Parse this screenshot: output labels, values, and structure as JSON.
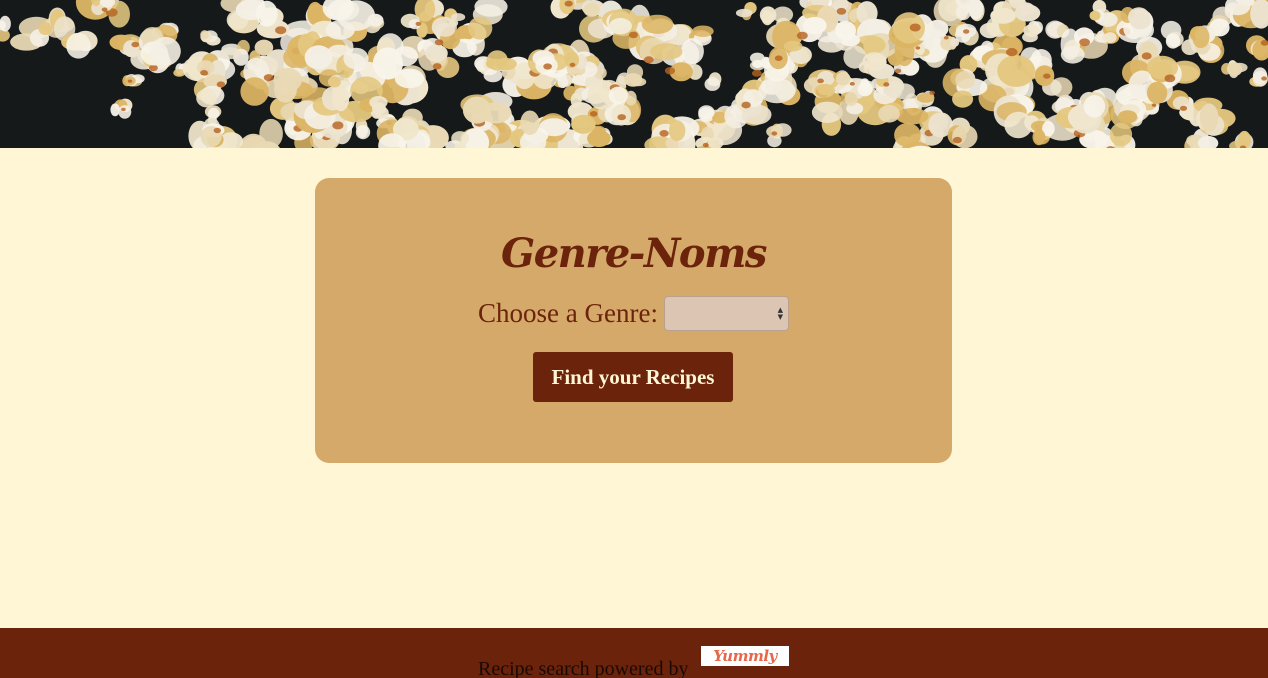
{
  "header": {
    "image_alt": "popcorn-banner"
  },
  "card": {
    "title": "Genre-Noms",
    "genre_label": "Choose a Genre:",
    "genre_selected": "",
    "find_button": "Find your Recipes"
  },
  "footer": {
    "powered_text": "Recipe search powered by",
    "logo_text": "Yummly"
  },
  "colors": {
    "background": "#fff6d5",
    "card": "#d4a96a",
    "accent": "#6b230b",
    "logo": "#e8664a"
  }
}
